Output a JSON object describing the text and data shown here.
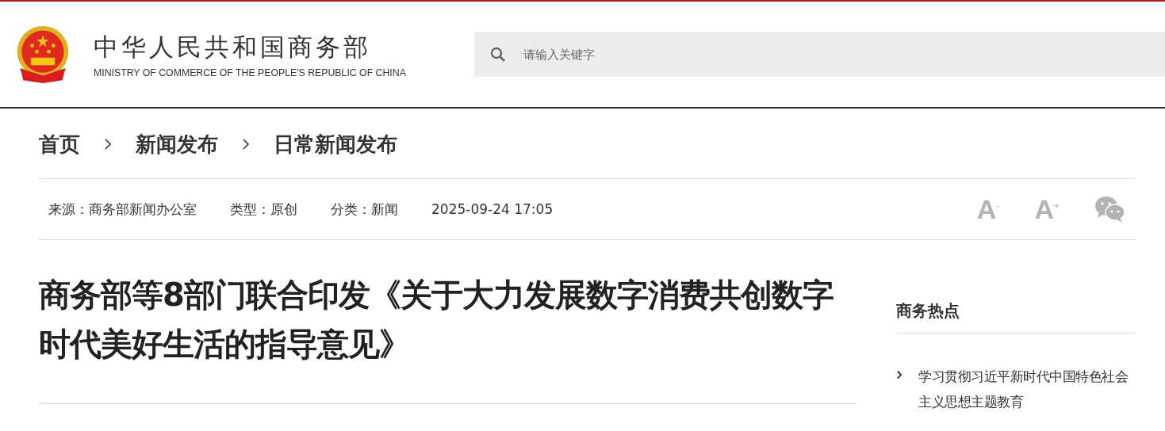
{
  "header": {
    "title": "中华人民共和国商务部",
    "subtitle": "MINISTRY OF COMMERCE OF THE PEOPLE'S REPUBLIC OF CHINA"
  },
  "search": {
    "placeholder": "请输入关键字"
  },
  "breadcrumb": [
    "首页",
    "新闻发布",
    "日常新闻发布"
  ],
  "meta": [
    "来源：商务部新闻办公室",
    "类型：原创",
    "分类：新闻",
    "2025-09-24 17:05"
  ],
  "tools": [
    {
      "kind": "font",
      "label": "A$^{-}$"
    },
    {
      "kind": "font",
      "label": "A$^{+}$"
    },
    {
      "kind": "wechat"
    }
  ],
  "article": {
    "title": "商务部等8部门联合印发《关于大力发展数字消费共创数字时代美好生活的指导意见》"
  },
  "sidebar": {
    "heading": "商务热点",
    "items": [
      "学习贯彻习近平新时代中国特色社会主义思想主题教育"
    ]
  }
}
